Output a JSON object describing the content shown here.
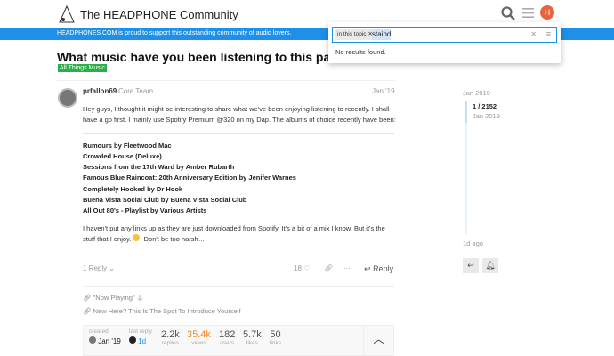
{
  "header": {
    "site_title": "The HEADPHONE Community",
    "avatar_letter": "H"
  },
  "banner": "HEADPHONES.COM is proud to support this outstanding community of audio lovers.",
  "search": {
    "scope_chip": "in this topic",
    "query": "staind",
    "no_results": "No results found."
  },
  "topic": {
    "title": "What music have you been listening to this past w",
    "category": "All Things Music"
  },
  "post": {
    "username": "prfallon69",
    "role": "Core Team",
    "date": "Jan '19",
    "intro": "Hey guys, I thought it might be interesting to share what we've been enjoying listening to recently. I shall have a go first. I mainly use Spotify Premium @320 on my Dap. The albums of choice recently have been:",
    "albums": [
      "Rumours by Fleetwood Mac",
      "Crowded House (Deluxe)",
      "Sessions from the 17th Ward by Amber Rubarth",
      "Famous Blue Raincoat: 20th Anniversary Edition by Jenifer Warnes",
      "Completely Hooked by Dr Hook",
      "Buena Vista Social Club by Buena Vista Social Club",
      "All Out 80's - Playlist by Various Artists"
    ],
    "outro1": "I haven't put any links up as they are just downloaded from Spotify. It's a bit of a mix I know. But it's the stuff that I enjoy.",
    "outro2": ". Don't be too harsh…",
    "replies_label": "1 Reply",
    "likes": "18",
    "reply_label": "Reply"
  },
  "links": [
    {
      "text": "\"Now Playing\"",
      "count": "2"
    },
    {
      "text": "New Here? This Is The Spot To Introduce Yourself"
    }
  ],
  "stats": {
    "created_label": "created",
    "created": "Jan '19",
    "last_reply_label": "last reply",
    "last_reply": "1d",
    "items": [
      {
        "n": "2.2k",
        "l": "replies"
      },
      {
        "n": "35.4k",
        "l": "views"
      },
      {
        "n": "182",
        "l": "users"
      },
      {
        "n": "5.7k",
        "l": "likes"
      },
      {
        "n": "50",
        "l": "links"
      }
    ]
  },
  "timeline": {
    "start": "Jan 2019",
    "position": "1 / 2152",
    "pos_date": "Jan 2019",
    "end": "1d ago"
  }
}
